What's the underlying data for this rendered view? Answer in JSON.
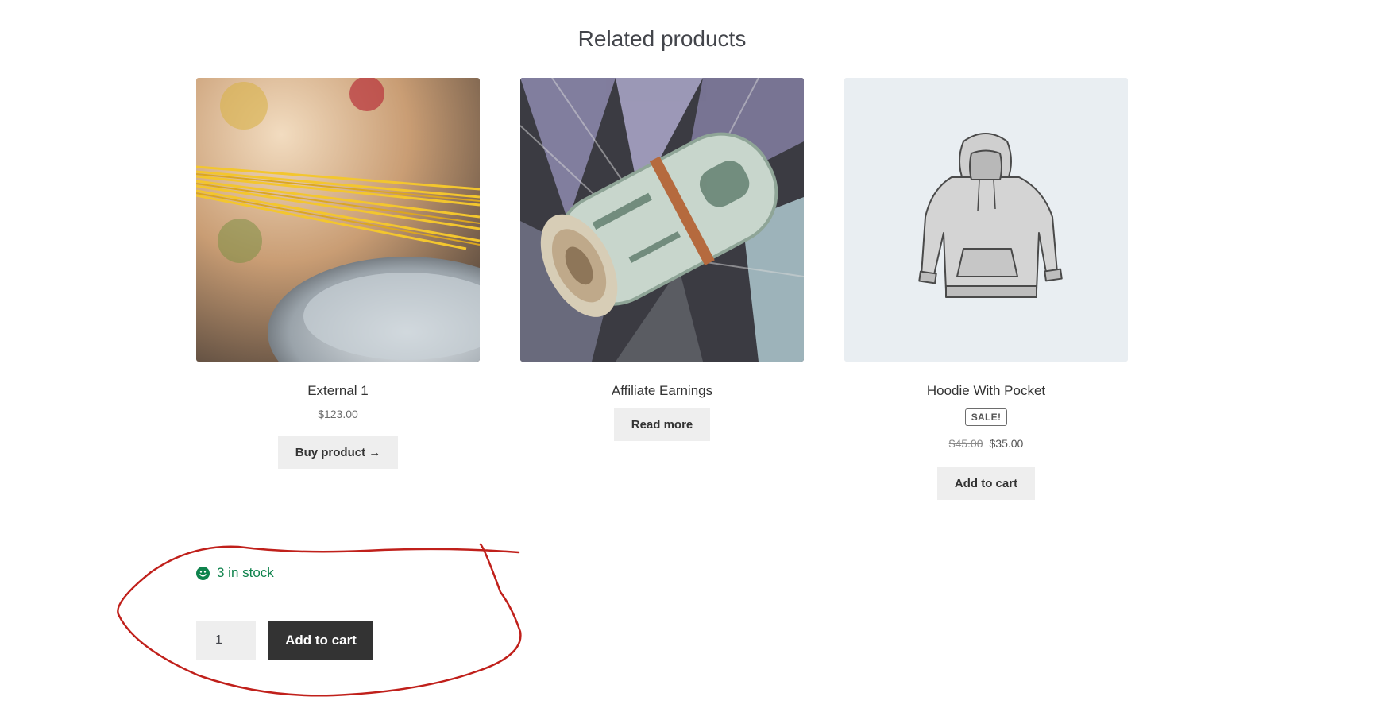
{
  "section": {
    "title": "Related products"
  },
  "products": [
    {
      "title": "External 1",
      "price": "$123.00",
      "button_label": "Buy product →",
      "image": "spaghetti-photo"
    },
    {
      "title": "Affiliate Earnings",
      "button_label": "Read more",
      "image": "money-roll-photo"
    },
    {
      "title": "Hoodie With Pocket",
      "sale_badge": "Sale!",
      "regular_price": "$45.00",
      "sale_price": "$35.00",
      "button_label": "Add to cart",
      "image": "hoodie-illustration"
    }
  ],
  "stock": {
    "text": "3 in stock",
    "icon": "smiley-icon",
    "color": "#0f834d"
  },
  "cart_form": {
    "quantity": "1",
    "add_to_cart_label": "Add to cart"
  },
  "annotation": {
    "color": "#c0201b"
  }
}
